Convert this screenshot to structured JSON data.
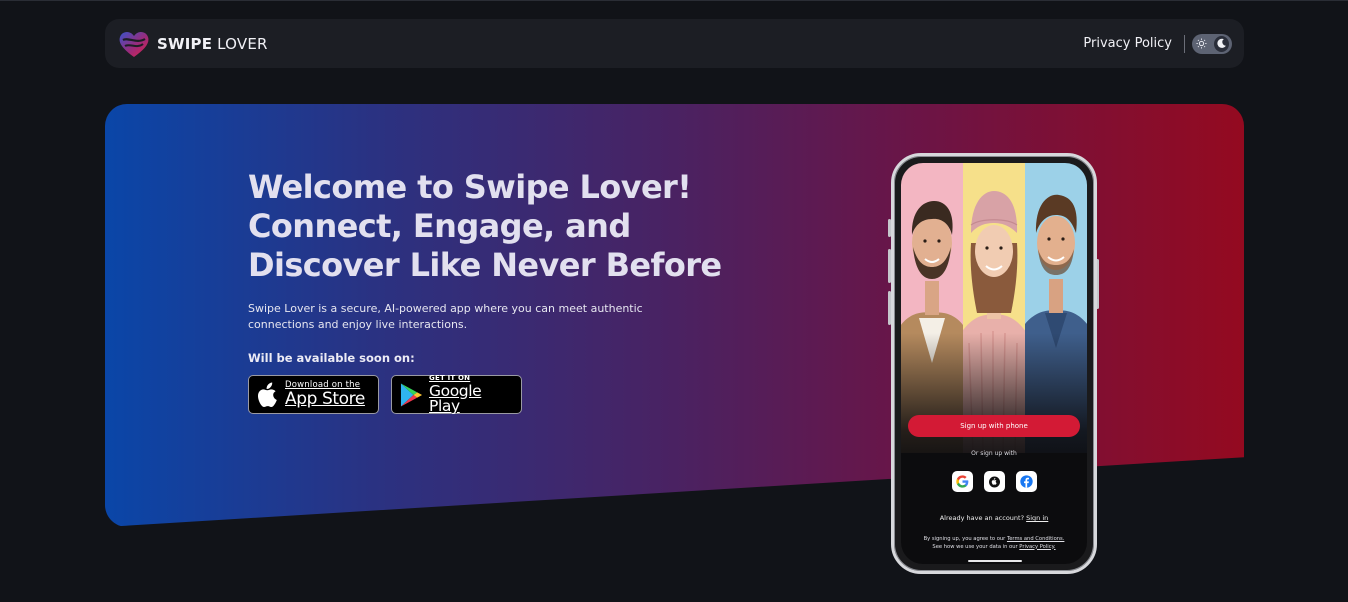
{
  "navbar": {
    "brand_bold": "SWIPE",
    "brand_light": "LOVER",
    "privacy_label": "Privacy Policy",
    "theme_toggle": {
      "light_icon": "sun-icon",
      "dark_icon": "moon-icon",
      "state": "dark"
    }
  },
  "hero": {
    "title_line1": "Welcome to Swipe Lover!",
    "title_line2": "Connect, Engage, and",
    "title_line3": "Discover Like Never Before",
    "description": "Swipe Lover is a secure, AI-powered app where you can meet authentic connections and enjoy live interactions.",
    "availability_label": "Will be available soon on:",
    "app_store": {
      "small": "Download on the",
      "big": "App Store",
      "icon": "apple-icon"
    },
    "google_play": {
      "small": "GET IT ON",
      "big": "Google Play",
      "icon": "google-play-icon"
    },
    "gradient_colors": [
      "#0a46a8",
      "#4a2262",
      "#940a20"
    ]
  },
  "phone": {
    "signup_phone_label": "Sign up with phone",
    "or_signup_label": "Or sign up with",
    "social_icons": [
      "google-icon",
      "apple-icon",
      "facebook-icon"
    ],
    "already_text": "Already have an account?",
    "signin_label": "Sign in",
    "legal_prefix": "By signing up, you agree to our",
    "terms_label": "Terms and Conditions.",
    "legal_middle": "See how we use your data in our",
    "privacy_label": "Privacy Policy.",
    "accent_color": "#d31a35"
  }
}
